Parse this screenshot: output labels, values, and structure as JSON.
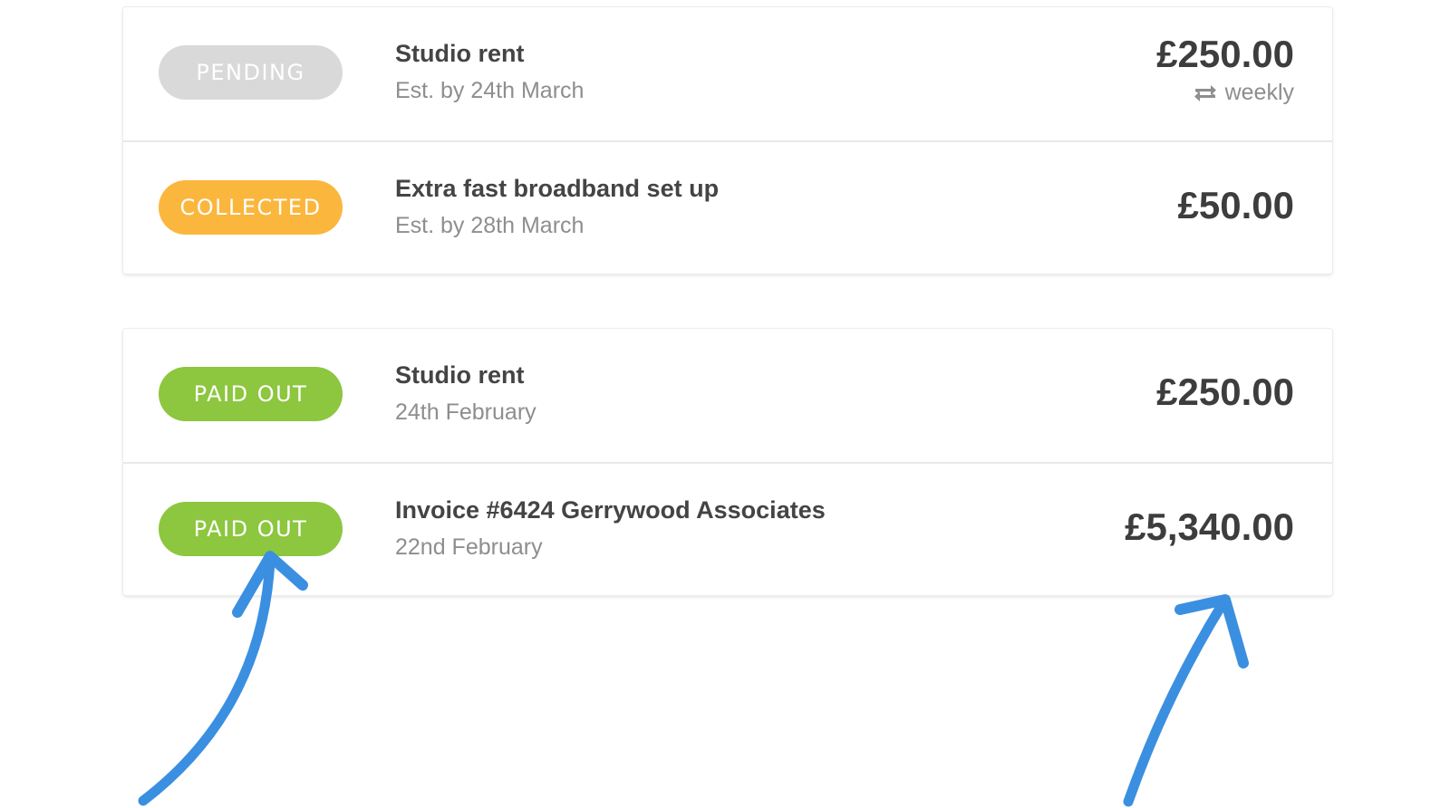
{
  "upcoming": [
    {
      "status": "PENDING",
      "status_color": "#d9d9d9",
      "title": "Studio rent",
      "subtitle": "Est. by 24th March",
      "amount": "£250.00",
      "recurrence": "weekly",
      "recurrence_icon": "repeat-icon"
    },
    {
      "status": "COLLECTED",
      "status_color": "#fbb63d",
      "title": "Extra fast broadband set up",
      "subtitle": "Est. by 28th March",
      "amount": "£50.00"
    }
  ],
  "past": [
    {
      "status": "PAID OUT",
      "status_color": "#8dc63f",
      "title": "Studio rent",
      "subtitle": "24th February",
      "amount": "£250.00"
    },
    {
      "status": "PAID OUT",
      "status_color": "#8dc63f",
      "title": "Invoice #6424 Gerrywood Associates",
      "subtitle": "22nd February",
      "amount": "£5,340.00"
    }
  ],
  "annotation_color": "#3b8fe0"
}
